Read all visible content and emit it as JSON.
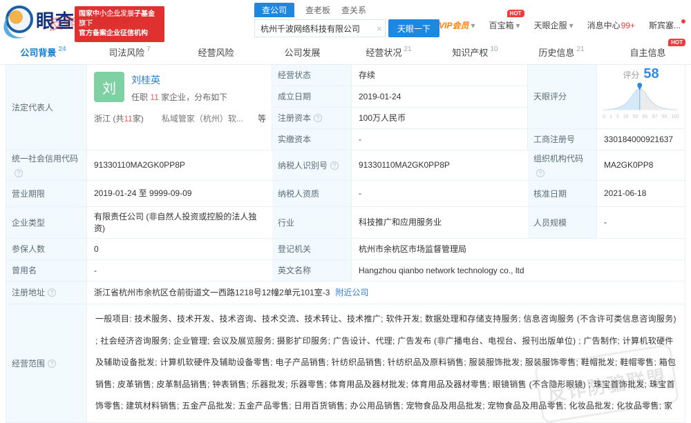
{
  "topbar": {
    "logo_text": "眼查",
    "badge": {
      "line1": "国家中小企业发展子基金旗下",
      "line2": "官方备案企业征信机构"
    },
    "search_tabs": {
      "company": "查公司",
      "boss": "查老板",
      "relation": "查关系"
    },
    "search_value": "杭州千波网络科技有限公司",
    "search_button": "天眼一下",
    "menu": {
      "vip": "VIP会员",
      "toolbox": "百宝箱",
      "toolbox_hot": "HOT",
      "enterprise": "天眼企服",
      "messages": "消息中心",
      "messages_count": "99+",
      "username": "斯宾塞..."
    }
  },
  "tabs": [
    {
      "label": "公司背景",
      "count": "24"
    },
    {
      "label": "司法风险",
      "count": "7"
    },
    {
      "label": "经营风险"
    },
    {
      "label": "公司发展"
    },
    {
      "label": "经营状况",
      "count": "21"
    },
    {
      "label": "知识产权",
      "count": "10"
    },
    {
      "label": "历史信息",
      "count": "21"
    },
    {
      "label": "自主信息",
      "hot": "HOT"
    }
  ],
  "rep": {
    "row_label": "法定代表人",
    "avatar": "刘",
    "name": "刘桂英",
    "tenure_prefix": "任职",
    "tenure_count": "11",
    "tenure_suffix": "家企业，分布如下",
    "region_prefix": "浙江 (共",
    "region_count": "11",
    "region_suffix": "家)",
    "company_short": "私域管家（杭州）软...",
    "more": "等"
  },
  "fields": {
    "status": {
      "label": "经营状态",
      "value": "存续"
    },
    "established": {
      "label": "成立日期",
      "value": "2019-01-24"
    },
    "reg_capital": {
      "label": "注册资本",
      "value": "100万人民币"
    },
    "paid_capital": {
      "label": "实缴资本",
      "value": "-"
    },
    "reg_no": {
      "label": "工商注册号",
      "value": "330184000921637"
    },
    "credit_code": {
      "label": "统一社会信用代码",
      "value": "91330110MA2GK0PP8P"
    },
    "taxpayer_id": {
      "label": "纳税人识别号",
      "value": "91330110MA2GK0PP8P"
    },
    "org_code": {
      "label": "组织机构代码",
      "value": "MA2GK0PP8"
    },
    "term": {
      "label": "营业期限",
      "value": "2019-01-24 至 9999-09-09"
    },
    "taxpayer_quality": {
      "label": "纳税人资质",
      "value": "-"
    },
    "approved_date": {
      "label": "核准日期",
      "value": "2021-06-18"
    },
    "company_type": {
      "label": "企业类型",
      "value": "有限责任公司 (非自然人投资或控股的法人独资)"
    },
    "industry": {
      "label": "行业",
      "value": "科技推广和应用服务业"
    },
    "staff_size": {
      "label": "人员规模",
      "value": "-"
    },
    "insured": {
      "label": "参保人数",
      "value": "0"
    },
    "registry": {
      "label": "登记机关",
      "value": "杭州市余杭区市场监督管理局"
    },
    "former_name": {
      "label": "曾用名",
      "value": "-"
    },
    "english_name": {
      "label": "英文名称",
      "value": "Hangzhou qianbo network technology co., ltd"
    },
    "address": {
      "label": "注册地址",
      "value": "浙江省杭州市余杭区仓前街道文一西路1218号12幢2单元101室-3",
      "link": "附近公司"
    },
    "scope": {
      "label": "经营范围",
      "value": "一般项目: 技术服务、技术开发、技术咨询、技术交流、技术转让、技术推广; 软件开发; 数据处理和存储支持服务; 信息咨询服务 (不含许可类信息咨询服务) ; 社会经济咨询服务; 企业管理; 会议及展览服务; 摄影扩印服务; 广告设计、代理; 广告发布 (非广播电台、电视台、报刊出版单位) ; 广告制作; 计算机软硬件及辅助设备批发; 计算机软硬件及辅助设备零售; 电子产品销售; 针纺织品销售; 针纺织品及原料销售; 服装服饰批发; 服装服饰零售; 鞋帽批发; 鞋帽零售; 箱包销售; 皮革销售; 皮革制品销售; 钟表销售; 乐器批发; 乐器零售; 体育用品及器材批发; 体育用品及器材零售; 眼镜销售 (不含隐形眼镜) ; 珠宝首饰批发; 珠宝首饰零售; 建筑材料销售; 五金产品批发; 五金产品零售; 日用百货销售; 办公用品销售; 宠物食品及用品批发; 宠物食品及用品零售; 化妆品批发; 化妆品零售; 家具销售; 家用电器销售; 通信设备销售; 化工产品销售 (不含许可类化工产品) ; 塑料制品销售; 橡胶制品销售; 销售代理; 照相机及器材销售; 第一类医疗器械销售; 食用农产品批发; 食用农产品零售; 鲜肉零售; 鲜肉批发; 新鲜蔬菜批发; 新鲜蔬菜零售; 新鲜水果零售; 新鲜水果批发(除依法须经批准的项目外，凭营业执照依法自主开展经营活动)。许可项目：第二类增值电信业务; 互联网信息服务; 出版物批发; 出版物零售; 音像制品复制; 食品经营 (销售预包装食品) ; 保健食品销售; 婴幼儿配方乳粉销售; 食品经营 (销售散装食品) ; 食品经营; 食品互联网销售; 技术进出口; 货物进出口(依法须经批准的项目，经相关部门批准后方可开展经营活动，具体经营项目以审批结果为准)。"
    }
  },
  "score": {
    "row_label": "天眼评分",
    "prefix": "评分",
    "value": "58",
    "ticks": [
      "0",
      "1",
      "5",
      "15",
      "50",
      "85",
      "97",
      "99",
      "100"
    ]
  },
  "chart_data": {
    "type": "area",
    "title": "天眼评分",
    "score": 58,
    "x_ticks": [
      0,
      1,
      5,
      15,
      50,
      85,
      97,
      99,
      100
    ],
    "marker_at": 58,
    "shape": "bell-curve"
  },
  "watermark": {
    "text": "反诈防骗联盟"
  },
  "colors": {
    "accent_blue": "#1e88e0",
    "badge_red": "#e03131",
    "vip_orange": "#ff7e00",
    "avatar_green": "#7fd0a2",
    "label_bg": "#f3fafd"
  }
}
